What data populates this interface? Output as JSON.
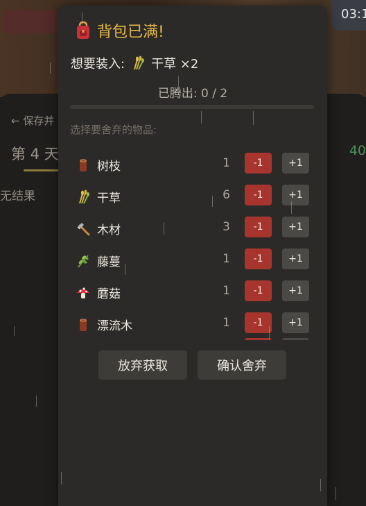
{
  "clock": "03:1",
  "background": {
    "back_label": "← 保存并",
    "day_label": "第 4 天",
    "empty_label": "无结果",
    "right_number": "40"
  },
  "modal": {
    "title": "背包已满!",
    "want_label": "想要装入:",
    "want_item_icon": "hay-icon",
    "want_item": "干草 ×2",
    "freed_text": "已腾出: 0 / 2",
    "freed_progress": 0,
    "select_label": "选择要舍弃的物品:",
    "items": [
      {
        "icon": "branch-icon",
        "name": "树枝",
        "count": "1",
        "minus": "-1",
        "plus": "+1"
      },
      {
        "icon": "hay-icon",
        "name": "干草",
        "count": "6",
        "minus": "-1",
        "plus": "+1"
      },
      {
        "icon": "wood-axe-icon",
        "name": "木材",
        "count": "3",
        "minus": "-1",
        "plus": "+1"
      },
      {
        "icon": "vine-icon",
        "name": "藤蔓",
        "count": "1",
        "minus": "-1",
        "plus": "+1"
      },
      {
        "icon": "mushroom-icon",
        "name": "蘑菇",
        "count": "1",
        "minus": "-1",
        "plus": "+1"
      },
      {
        "icon": "driftwood-icon",
        "name": "漂流木",
        "count": "1",
        "minus": "-1",
        "plus": "+1"
      }
    ],
    "giveup_label": "放弃获取",
    "confirm_label": "确认舍弃"
  },
  "colors": {
    "title": "#e7b84a",
    "minus_button": "#a8352d",
    "plus_button": "#4a4946",
    "modal_bg": "#2b2a28"
  }
}
